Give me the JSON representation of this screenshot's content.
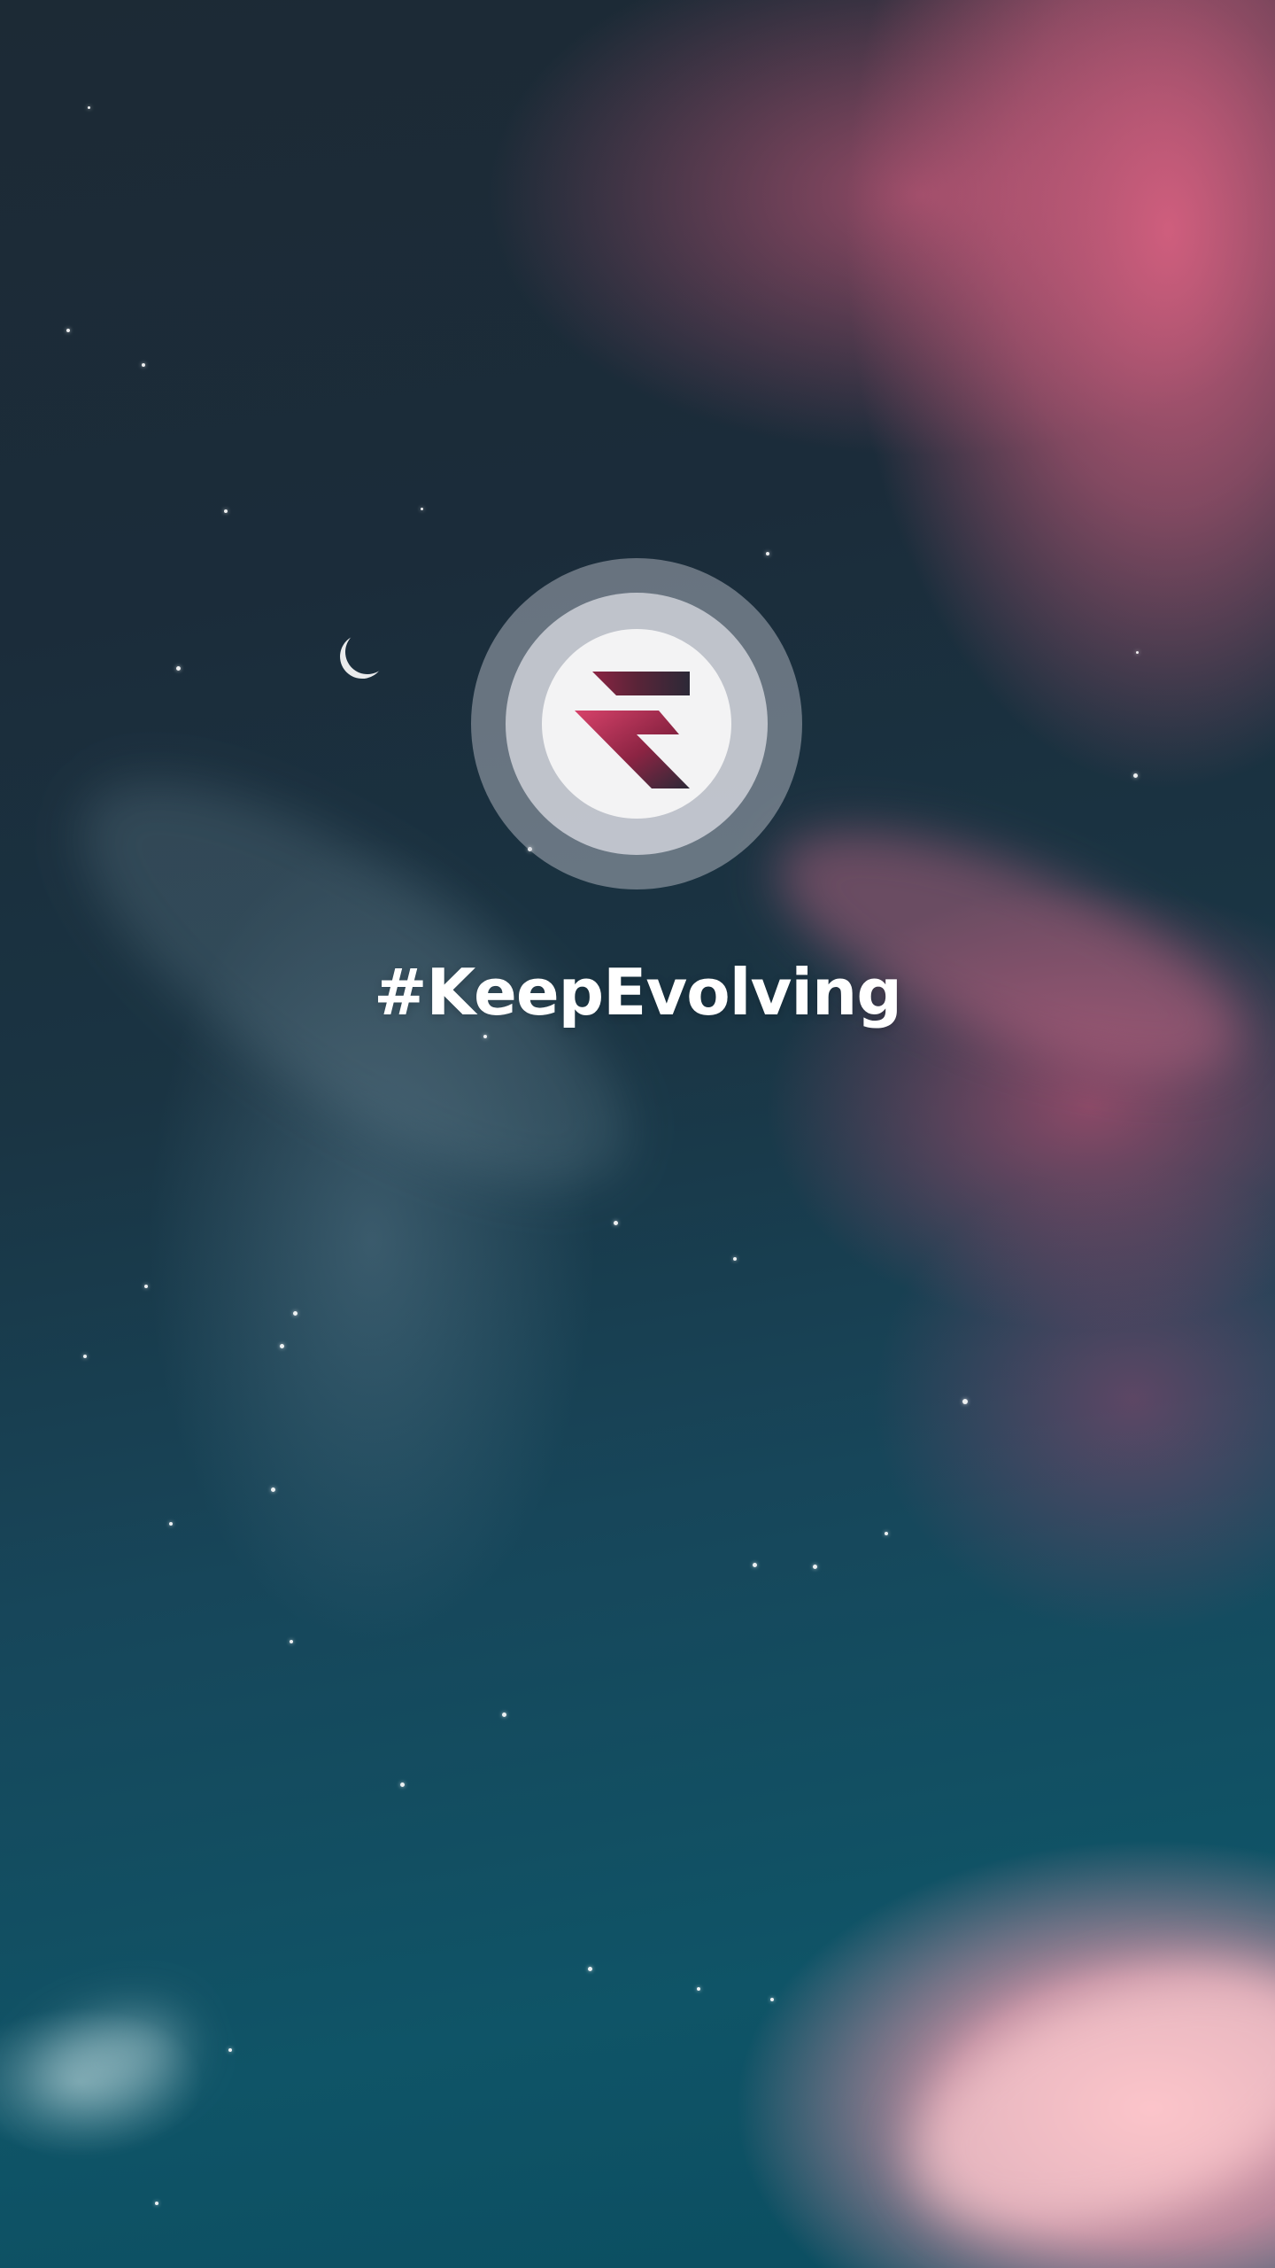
{
  "screen": {
    "tagline": "#KeepEvolving",
    "logo": {
      "icon": "stylized-f-logo-icon",
      "gradient_colors": [
        "#2c2937",
        "#8c2443",
        "#d7426a"
      ],
      "ring_colors": [
        "#c8cad2",
        "#dcdee4",
        "#f3f3f4"
      ]
    },
    "background": {
      "image": "night-sky-with-pink-clouds",
      "colors": [
        "#1c2a35",
        "#0f5467",
        "#d66080",
        "#f6b0ba"
      ]
    }
  }
}
